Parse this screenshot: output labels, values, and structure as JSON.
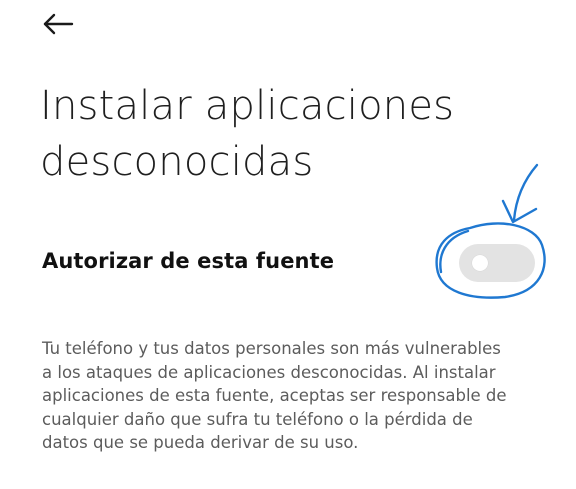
{
  "header": {
    "back_icon": "arrow-left-icon"
  },
  "page": {
    "title": "Instalar aplicaciones desconocidas"
  },
  "setting": {
    "label": "Autorizar de esta fuente",
    "toggle_state": "off"
  },
  "description": "Tu teléfono y tus datos personales son más vulnerables a los ataques de aplicaciones desconocidas. Al instalar aplicaciones de esta fuente, aceptas ser responsable de cualquier daño que sufra tu teléfono o la pérdida de datos que se pueda derivar de su uso.",
  "colors": {
    "annotation": "#1f78d1",
    "toggle_off": "#e3e3e3",
    "description_text": "#5c5c5c"
  }
}
